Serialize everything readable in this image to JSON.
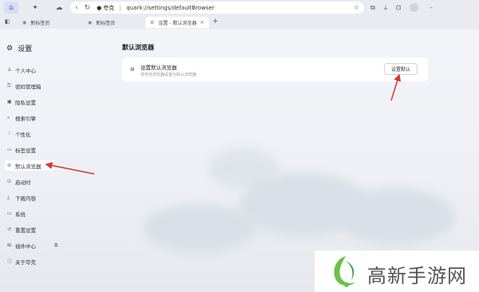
{
  "toolbar": {
    "address": {
      "site": "夸克",
      "url": "quark://settings/defaultBrowser"
    }
  },
  "tabs": [
    {
      "label": "新标签页"
    },
    {
      "label": "新标签页"
    },
    {
      "label": "设置 - 默认浏览器",
      "active": true
    }
  ],
  "sidebar": {
    "title": "设置",
    "items": [
      {
        "label": "个人中心",
        "icon": "person-icon"
      },
      {
        "label": "密码管理箱",
        "icon": "key-icon"
      },
      {
        "label": "隐私设置",
        "icon": "privacy-icon"
      },
      {
        "label": "搜索引擎",
        "icon": "search-icon"
      },
      {
        "label": "个性化",
        "icon": "bulb-icon"
      },
      {
        "label": "标签设置",
        "icon": "tab-icon"
      },
      {
        "label": "默认浏览器",
        "icon": "browser-icon",
        "active": true
      },
      {
        "label": "启动时",
        "icon": "power-icon"
      },
      {
        "label": "下载内容",
        "icon": "download-icon"
      },
      {
        "label": "系统",
        "icon": "monitor-icon"
      },
      {
        "label": "重置设置",
        "icon": "reset-icon"
      },
      {
        "label": "插件中心",
        "icon": "grid-icon"
      },
      {
        "label": "关于夸克",
        "icon": "info-icon"
      }
    ]
  },
  "main": {
    "title": "默认浏览器",
    "card": {
      "title": "设置默认浏览器",
      "desc": "将夸克浏览器设置为默认浏览器",
      "button": "设置默认"
    }
  },
  "watermark": {
    "text": "高新手游网"
  },
  "colors": {
    "arrow": "#d9362b",
    "watermark_green": "#6cc04a",
    "accent": "#4b5fd1"
  }
}
